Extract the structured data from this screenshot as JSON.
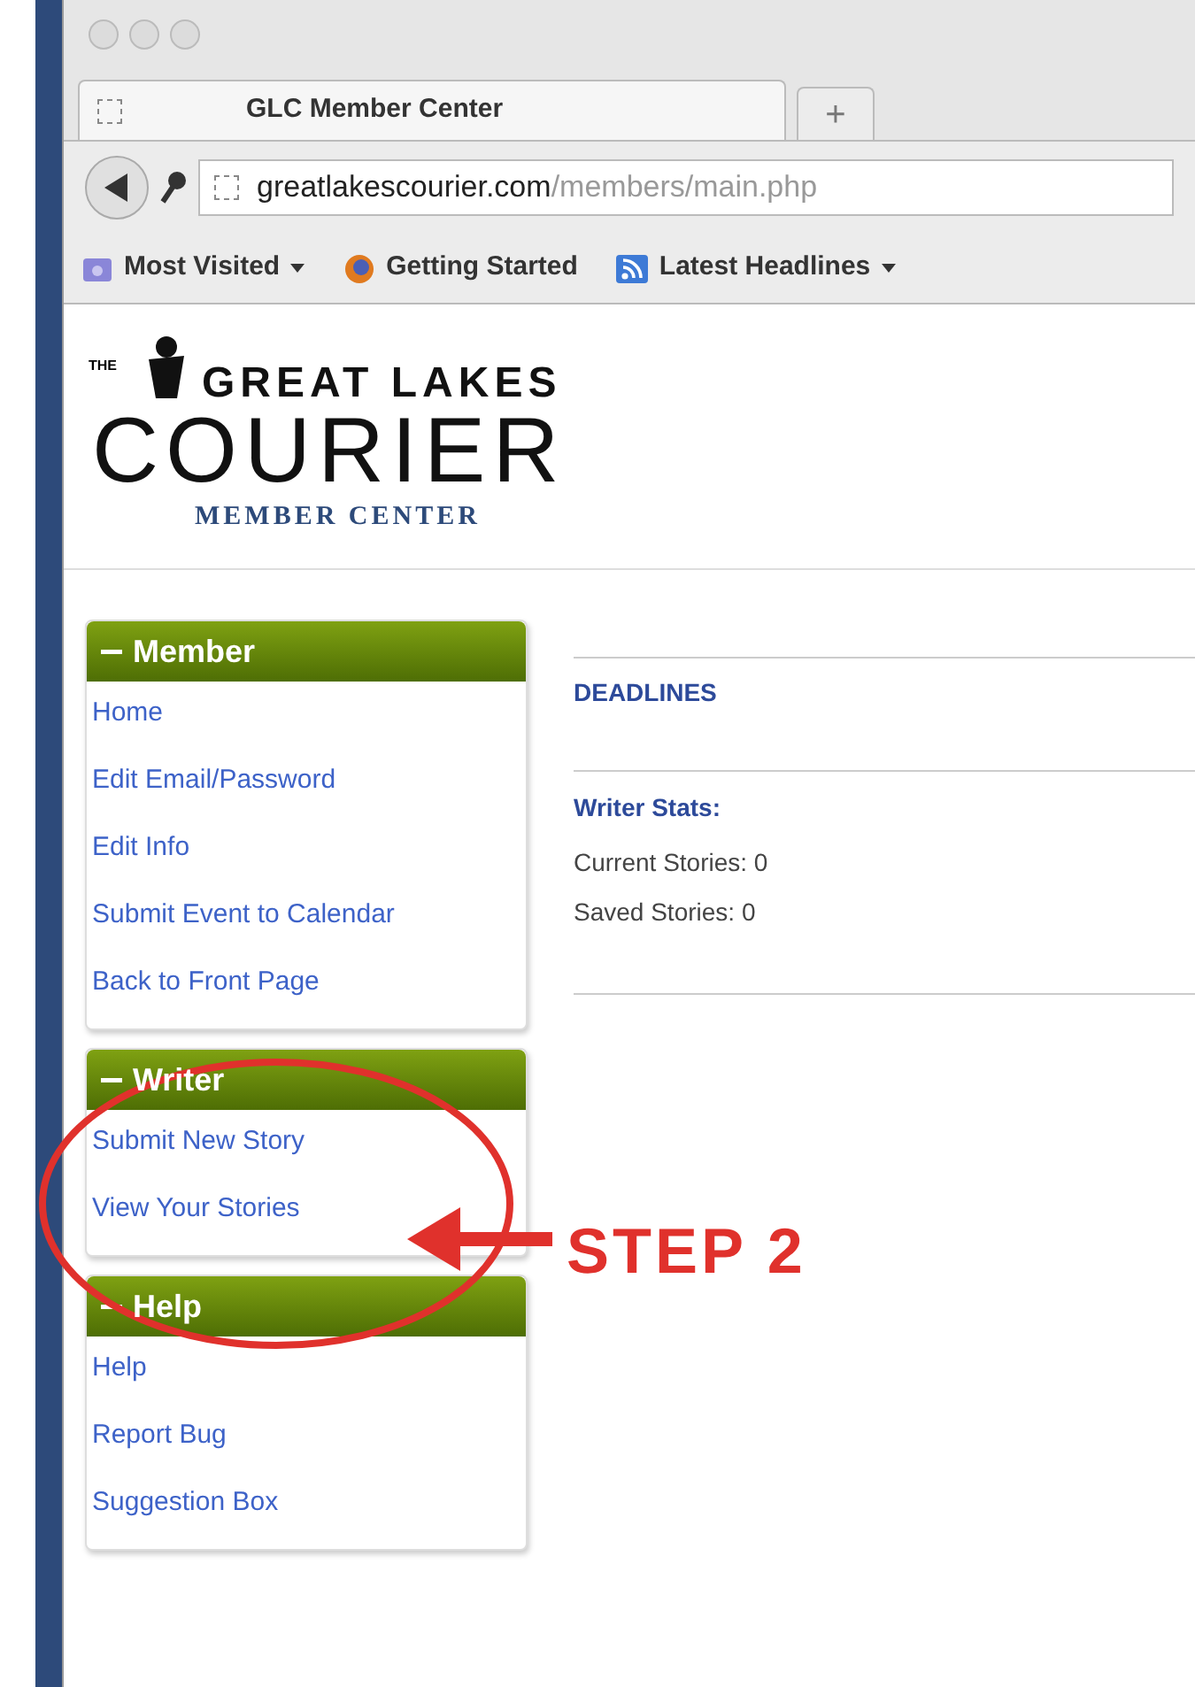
{
  "browser": {
    "tab_title": "GLC Member Center",
    "new_tab": "+",
    "url_domain": "greatlakescourier.com",
    "url_path": "/members/main.php",
    "bookmarks": [
      {
        "label": "Most Visited",
        "dropdown": true,
        "kind": "folder"
      },
      {
        "label": "Getting Started",
        "dropdown": false,
        "kind": "globe"
      },
      {
        "label": "Latest Headlines",
        "dropdown": true,
        "kind": "rss"
      }
    ]
  },
  "logo": {
    "the": "THE",
    "line1": "GREAT LAKES",
    "line2": "COURIER",
    "subtitle": "MEMBER CENTER"
  },
  "sidebar": [
    {
      "title": "Member",
      "expanded": true,
      "links": [
        "Home",
        "Edit Email/Password",
        "Edit Info",
        "Submit Event to Calendar",
        "Back to Front Page"
      ]
    },
    {
      "title": "Writer",
      "expanded": true,
      "links": [
        "Submit New Story",
        "View Your Stories"
      ]
    },
    {
      "title": "Help",
      "expanded": true,
      "links": [
        "Help",
        "Report Bug",
        "Suggestion Box"
      ]
    }
  ],
  "main": {
    "heading": "DEADLINES",
    "stats_title": "Writer Stats:",
    "stats": [
      "Current Stories: 0",
      "Saved Stories: 0"
    ]
  },
  "annotation": {
    "label": "STEP 2"
  }
}
